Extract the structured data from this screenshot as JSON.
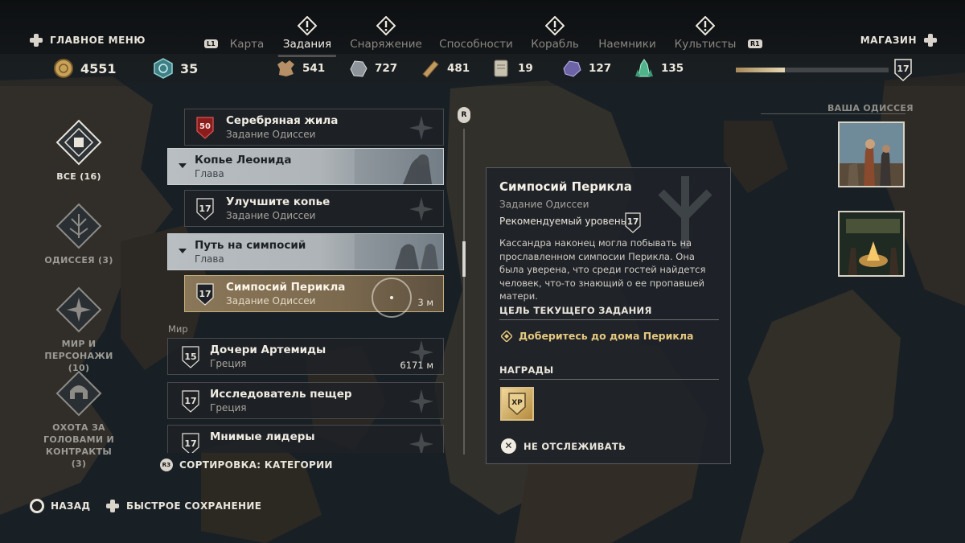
{
  "top": {
    "main_menu_label": "ГЛАВНОЕ МЕНЮ",
    "shop_label": "МАГАЗИН",
    "left_bumper": "L1",
    "right_bumper": "R1",
    "tabs": [
      {
        "label": "Карта",
        "active": false,
        "alert": false
      },
      {
        "label": "Задания",
        "active": true,
        "alert": true
      },
      {
        "label": "Снаряжение",
        "active": false,
        "alert": true
      },
      {
        "label": "Способности",
        "active": false,
        "alert": false
      },
      {
        "label": "Корабль",
        "active": false,
        "alert": true
      },
      {
        "label": "Наемники",
        "active": false,
        "alert": false
      },
      {
        "label": "Культисты",
        "active": false,
        "alert": true
      }
    ]
  },
  "resources": {
    "drachmae": "4551",
    "ability_points": "35",
    "leather": "541",
    "iron": "727",
    "wood": "481",
    "stone": "19",
    "obsidian": "127",
    "crystal": "135",
    "xp_progress": 0.32,
    "level": "17"
  },
  "categories": [
    {
      "label": "ВСЕ (16)",
      "active": true
    },
    {
      "label": "ОДИССЕЯ (3)",
      "active": false
    },
    {
      "label": "МИР И ПЕРСОНАЖИ (10)",
      "active": false
    },
    {
      "label": "ОХОТА ЗА ГОЛОВАМИ И КОНТРАКТЫ (3)",
      "active": false
    }
  ],
  "quests": {
    "q1": {
      "level": "50",
      "title": "Серебряная жила",
      "subtitle": "Задание Одиссеи"
    },
    "ch1": {
      "title": "Копье Леонида",
      "subtitle": "Глава"
    },
    "q2": {
      "level": "17",
      "title": "Улучшите копье",
      "subtitle": "Задание Одиссеи"
    },
    "ch2": {
      "title": "Путь на симпосий",
      "subtitle": "Глава"
    },
    "q3": {
      "level": "17",
      "title": "Симпосий Перикла",
      "subtitle": "Задание Одиссеи",
      "distance": "3 м"
    },
    "section_world": "Мир",
    "w1": {
      "level": "15",
      "title": "Дочери Артемиды",
      "subtitle": "Греция",
      "distance": "6171 м"
    },
    "w2": {
      "level": "17",
      "title": "Исследователь пещер",
      "subtitle": "Греция"
    },
    "w3": {
      "level": "17",
      "title": "Мнимые лидеры"
    }
  },
  "scroll_button": "R",
  "sort": {
    "button": "R3",
    "label": "СОРТИРОВКА: КАТЕГОРИИ"
  },
  "detail": {
    "title": "Симпосий Перикла",
    "type": "Задание Одиссеи",
    "recommended_label": "Рекомендуемый уровень",
    "recommended_level": "17",
    "description": "Кассандра наконец могла побывать на прославленном симпосии Перикла. Она была уверена, что среди гостей найдется человек, что-то знающий о ее пропавшей матери.",
    "objective_header": "ЦЕЛЬ ТЕКУЩЕГО ЗАДАНИЯ",
    "objective": "Доберитесь до дома Перикла",
    "rewards_header": "НАГРАДЫ",
    "reward_xp": "XP",
    "untrack_label": "НЕ ОТСЛЕЖИВАТЬ"
  },
  "odyssey_label": "ВАША ОДИССЕЯ",
  "bottom": {
    "back_label": "НАЗАД",
    "quicksave_label": "БЫСТРОЕ СОХРАНЕНИЕ"
  },
  "colors": {
    "accent_gold": "#e6c97f",
    "selected_bg": "#7c6a4f",
    "level50_red": "#8b1c1c"
  }
}
